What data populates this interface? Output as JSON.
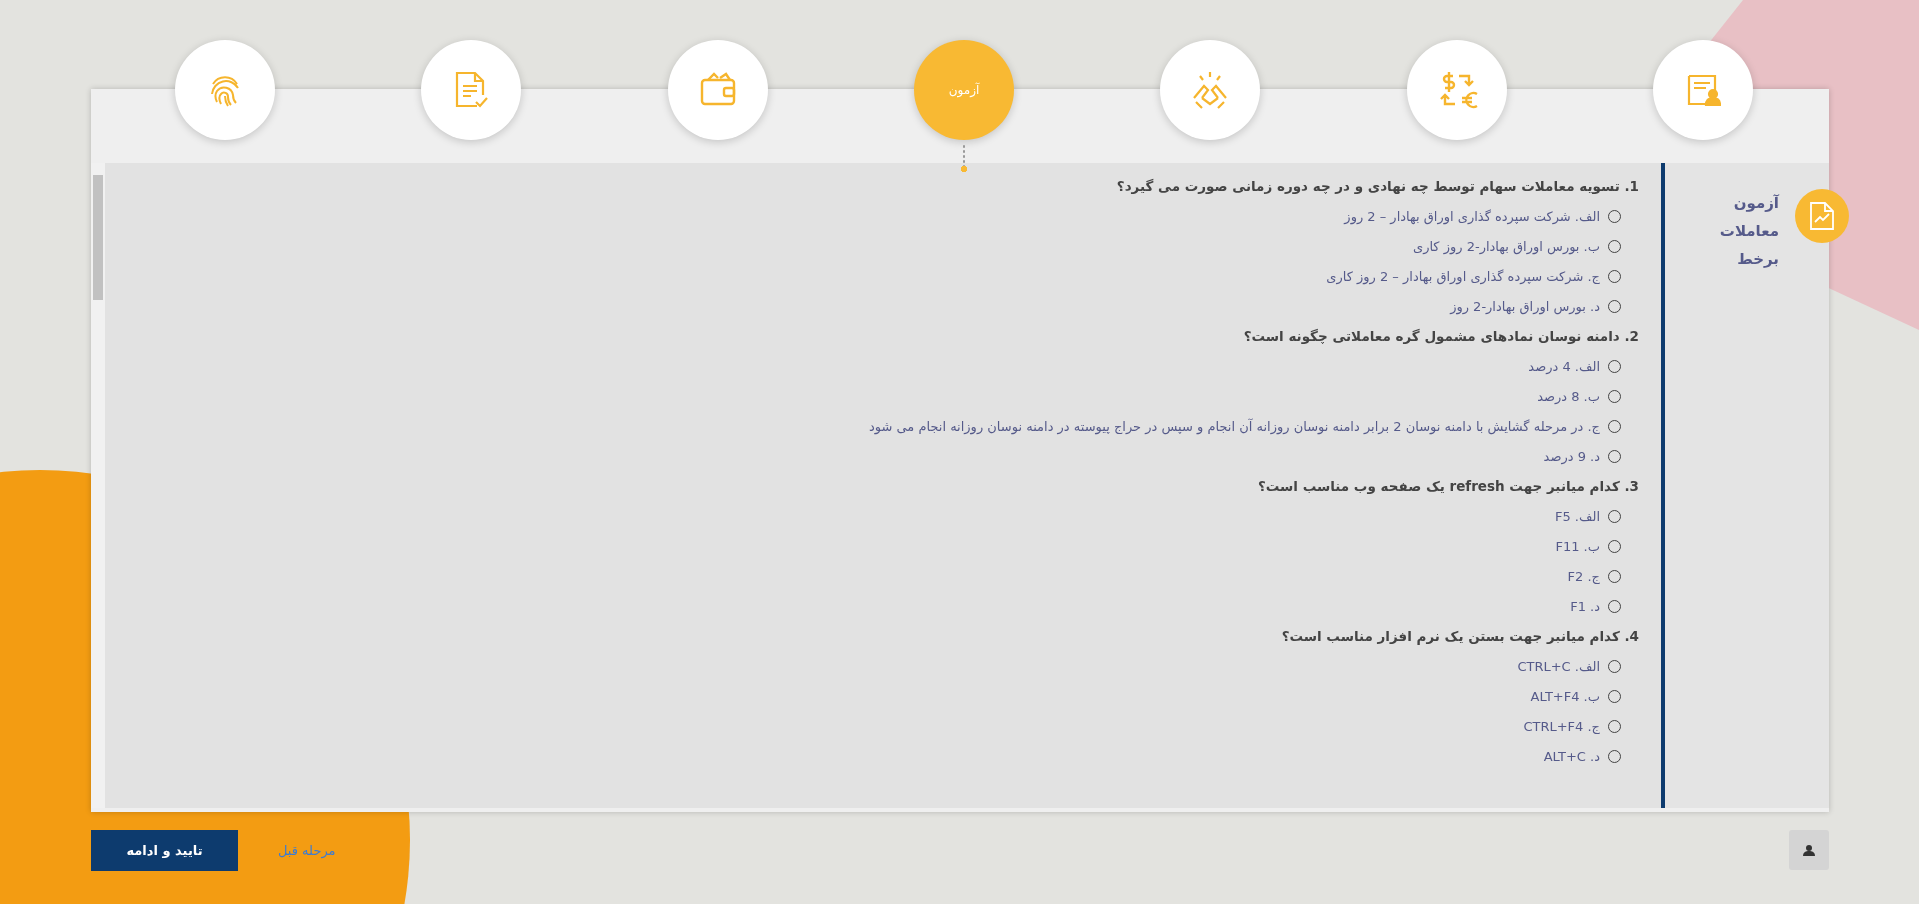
{
  "steps": [
    {
      "kind": "id-card",
      "selected": false
    },
    {
      "kind": "exchange",
      "selected": false
    },
    {
      "kind": "handshake",
      "selected": false
    },
    {
      "kind": "label",
      "label": "آزمون",
      "selected": true
    },
    {
      "kind": "wallet",
      "selected": false
    },
    {
      "kind": "document",
      "selected": false
    },
    {
      "kind": "fingerprint",
      "selected": false
    }
  ],
  "sidebar": {
    "title": "آزمون معاملات برخط"
  },
  "questions": [
    {
      "text": "1. تسویه معاملات سهام توسط چه نهادی و در چه دوره زمانی صورت می گیرد؟",
      "options": [
        {
          "text": "الف. شرکت سپرده گذاری اوراق بهادار – 2 روز",
          "selected": false
        },
        {
          "text": "ب. بورس اوراق بهادار-2 روز کاری",
          "selected": false
        },
        {
          "text": "ج. شرکت سپرده گذاری اوراق بهادار – 2 روز کاری",
          "selected": false
        },
        {
          "text": "د. بورس اوراق بهادار-2 روز",
          "selected": false
        }
      ]
    },
    {
      "text": "2. دامنه نوسان نمادهای مشمول گره معاملاتی چگونه است؟",
      "options": [
        {
          "text": "الف. 4 درصد",
          "selected": false
        },
        {
          "text": "ب. 8 درصد",
          "selected": false
        },
        {
          "text": "ج. در مرحله گشایش با دامنه نوسان 2 برابر دامنه نوسان روزانه آن انجام و سپس در حراج پیوسته در دامنه نوسان روزانه انجام می شود",
          "selected": false
        },
        {
          "text": "د. 9 درصد",
          "selected": false
        }
      ]
    },
    {
      "text": "3. کدام میانبر جهت refresh یک صفحه وب مناسب است؟",
      "options": [
        {
          "text": "الف. F5",
          "selected": false
        },
        {
          "text": "ب. F11",
          "selected": false
        },
        {
          "text": "ج. F2",
          "selected": false
        },
        {
          "text": "د. F1",
          "selected": false
        }
      ]
    },
    {
      "text": "4. کدام میانبر جهت بستن یک نرم افزار مناسب است؟",
      "options": [
        {
          "text": "الف. CTRL+C",
          "selected": false
        },
        {
          "text": "ب. ALT+F4",
          "selected": false
        },
        {
          "text": "ج. CTRL+F4",
          "selected": false
        },
        {
          "text": "د. ALT+C",
          "selected": false
        }
      ]
    }
  ],
  "buttons": {
    "confirm": "تایید و ادامه",
    "back": "مرحله قبل"
  }
}
